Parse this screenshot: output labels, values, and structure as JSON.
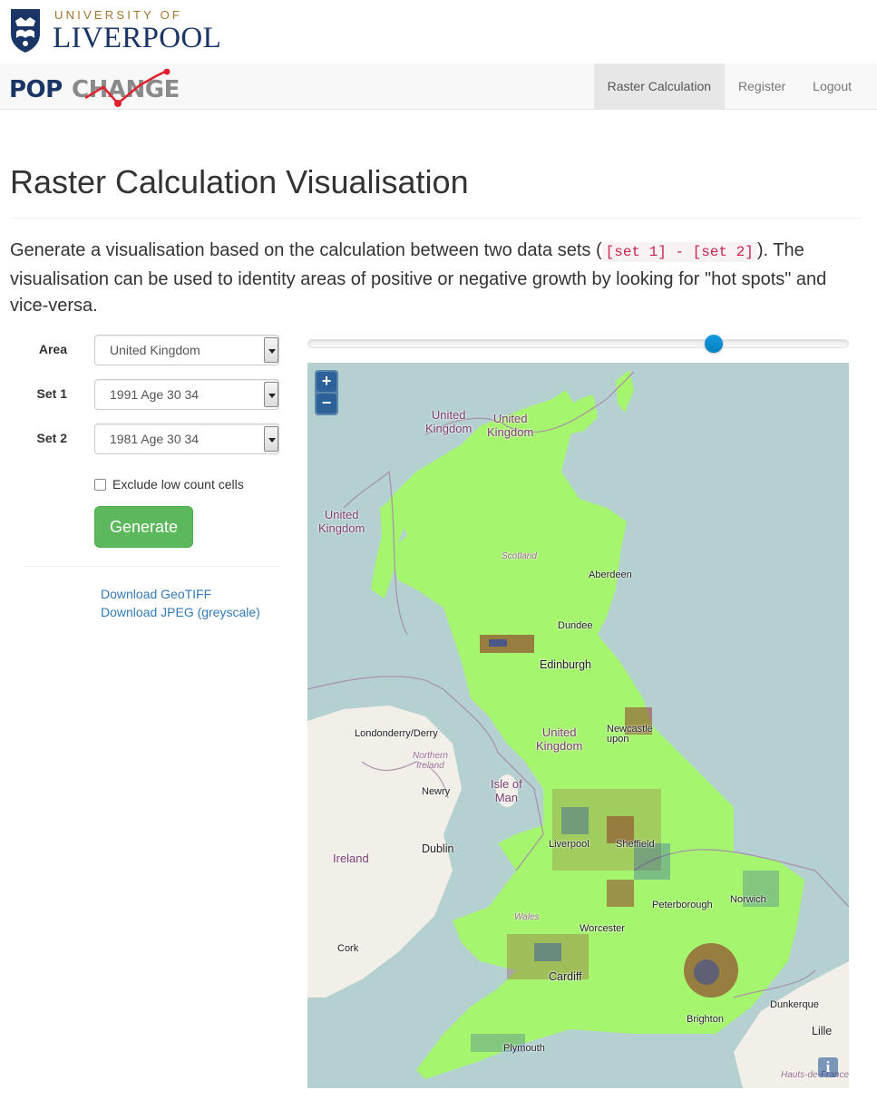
{
  "university": {
    "line1": "UNIVERSITY OF",
    "line2": "LIVERPOOL"
  },
  "brand": {
    "pop": "POP",
    "change": "CHANGE"
  },
  "nav": {
    "items": [
      {
        "label": "Raster Calculation",
        "active": true
      },
      {
        "label": "Register",
        "active": false
      },
      {
        "label": "Logout",
        "active": false
      }
    ]
  },
  "page": {
    "title": "Raster Calculation Visualisation",
    "lead_before": "Generate a visualisation based on the calculation between two data sets (",
    "lead_code": "[set 1] - [set 2]",
    "lead_after": "). The visualisation can be used to identity areas of positive or negative growth by looking for \"hot spots\" and vice-versa."
  },
  "form": {
    "area_label": "Area",
    "area_value": "United Kingdom",
    "set1_label": "Set 1",
    "set1_value": "1991 Age 30 34",
    "set2_label": "Set 2",
    "set2_value": "1981 Age 30 34",
    "exclude_label": "Exclude low count cells",
    "exclude_checked": false,
    "generate_label": "Generate",
    "download_geotiff": "Download GeoTIFF",
    "download_jpeg": "Download JPEG (greyscale)"
  },
  "slider": {
    "value": 0.75
  },
  "map": {
    "zoom_in": "+",
    "zoom_out": "−",
    "info": "i",
    "labels": {
      "uk1": "United\nKingdom",
      "uk2": "United\nKingdom",
      "uk3": "United\nKingdom",
      "uk4": "United\nKingdom",
      "aberdeen": "Aberdeen",
      "dundee": "Dundee",
      "edinburgh": "Edinburgh",
      "scotland": "Scotland",
      "londonderry": "Londonderry/Derry",
      "northern_ireland": "Northern\nIreland",
      "newry": "Newry",
      "isle_of_man": "Isle of\nMan",
      "ireland": "Ireland",
      "dublin": "Dublin",
      "cork": "Cork",
      "newcastle": "Newcastle\nupon",
      "liverpool": "Liverpool",
      "sheffield": "Sheffield",
      "wales": "Wales",
      "cardiff": "Cardiff",
      "plymouth": "Plymouth",
      "dunkerque": "Dunkerque",
      "lille": "Lille",
      "hauts": "Hauts-de-France",
      "peterborough": "Peterborough",
      "norwich": "Norwich",
      "worcester": "Worcester",
      "brighton": "Brighton"
    }
  },
  "colors": {
    "raster_base": "#a6f56e",
    "hot": "#8b1a1a",
    "cold": "#1a3fb5",
    "sea": "#b5d0d0",
    "land": "#f2efe9",
    "accent_green": "#5cb85c",
    "link": "#337ab7"
  }
}
